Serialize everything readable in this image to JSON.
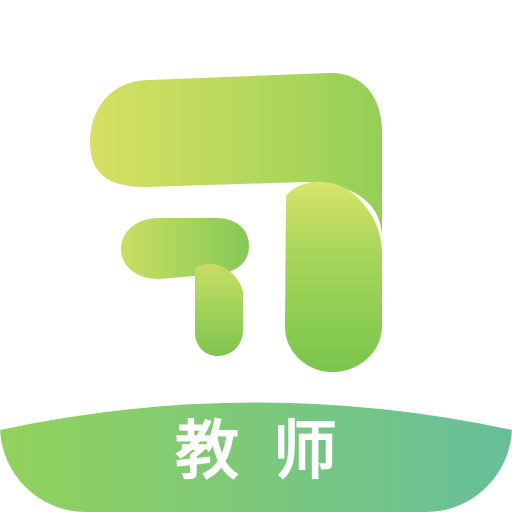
{
  "app_icon": {
    "label": "教师",
    "logo_icon": "stylized-hook-leaf-logo",
    "colors": {
      "background": "#ffffff",
      "logo_light": "#d2df63",
      "logo_mid": "#a9d45a",
      "logo_dark": "#79c64e",
      "band_left": "#93d25a",
      "band_right": "#66bf9a",
      "label_text": "#ffffff"
    }
  }
}
